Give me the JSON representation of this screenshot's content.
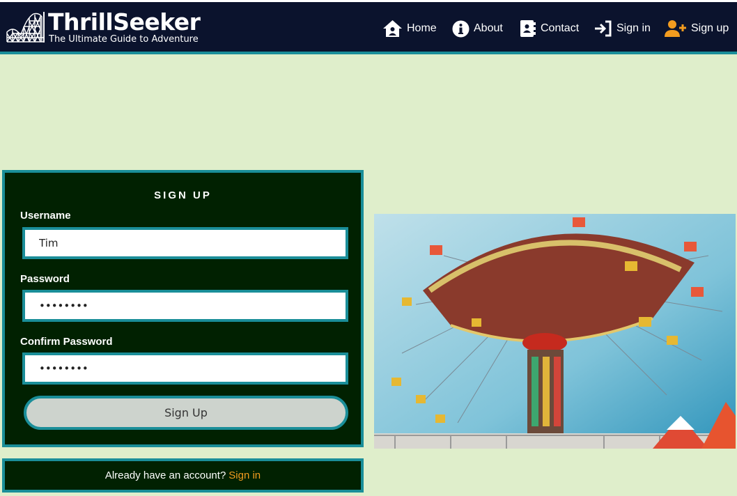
{
  "brand": {
    "title": "ThrillSeeker",
    "subtitle": "The Ultimate Guide to Adventure",
    "logo_icon": "roller-coaster-icon"
  },
  "nav": {
    "home": "Home",
    "about": "About",
    "contact": "Contact",
    "signin": "Sign in",
    "signup": "Sign up"
  },
  "form": {
    "title": "SIGN UP",
    "username_label": "Username",
    "username_value": "Tim",
    "password_label": "Password",
    "password_value": "password",
    "confirm_label": "Confirm Password",
    "confirm_value": "password",
    "submit_label": "Sign Up"
  },
  "signin_prompt": {
    "text": "Already have an account?",
    "link": "Sign in"
  },
  "photo": {
    "subject": "swing-carousel-ride-photo"
  },
  "colors": {
    "header_bg": "#0b132d",
    "accent_teal": "#1a8e99",
    "page_bg": "#dfeecb",
    "card_bg": "#012101",
    "link_orange": "#f39c1f",
    "button_bg": "#cdd3cd"
  }
}
